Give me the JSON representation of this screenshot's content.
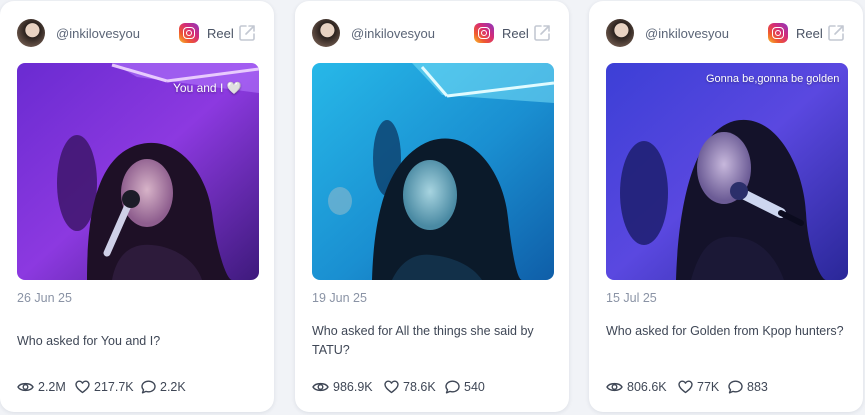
{
  "platform": "Reel",
  "icons": {
    "instagram": "instagram-icon",
    "external": "external-link-icon",
    "views": "eye-icon",
    "likes": "heart-icon",
    "comments": "comment-icon"
  },
  "colors": {
    "card_bg": "#ffffff",
    "page_bg": "#f1f3f7",
    "text_muted": "#8a93a5",
    "text_main": "#3f4756"
  },
  "posts": [
    {
      "handle": "@inkilovesyou",
      "platform": "Reel",
      "overlay_text": "You and I 🤍",
      "date": "26 Jun 25",
      "caption": "Who asked for You and I?",
      "views": "2.2M",
      "likes": "217.7K",
      "comments": "2.2K"
    },
    {
      "handle": "@inkilovesyou",
      "platform": "Reel",
      "overlay_text": "",
      "date": "19 Jun 25",
      "caption": "Who asked for All the things she said by TATU?",
      "views": "986.9K",
      "likes": "78.6K",
      "comments": "540"
    },
    {
      "handle": "@inkilovesyou",
      "platform": "Reel",
      "overlay_text": "Gonna be,gonna be golden",
      "date": "15 Jul 25",
      "caption": "Who asked for Golden from Kpop hunters?",
      "views": "806.6K",
      "likes": "77K",
      "comments": "883"
    }
  ]
}
